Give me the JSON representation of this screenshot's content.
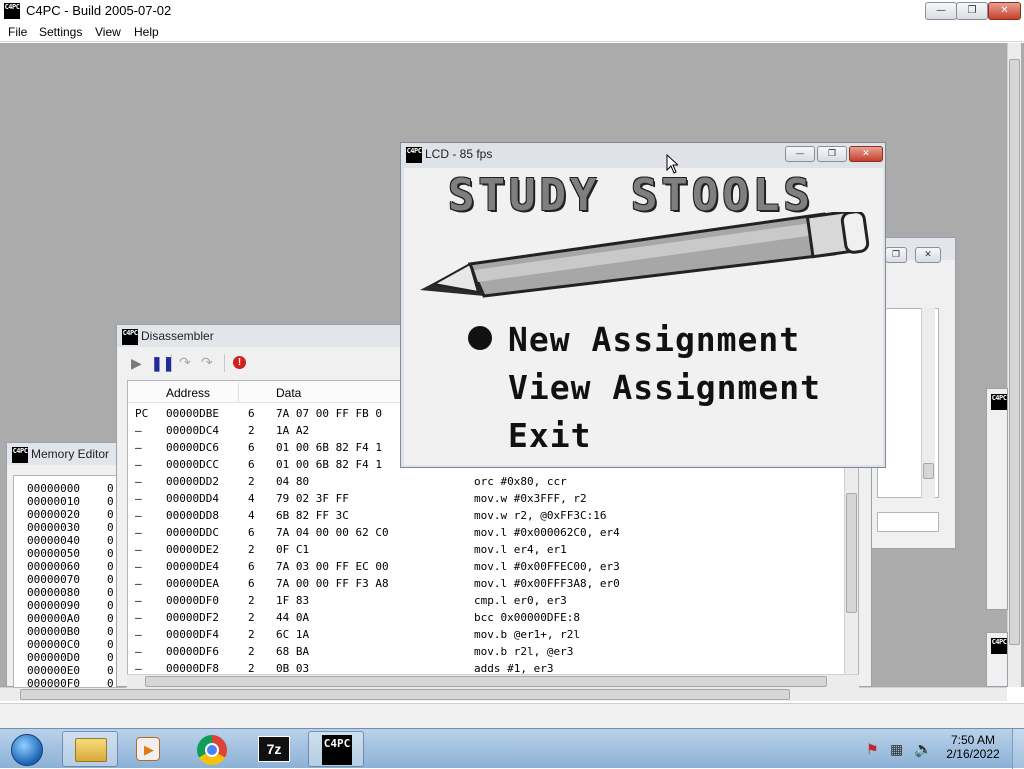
{
  "window": {
    "title": "C4PC - Build 2005-07-02",
    "icon_text": "C4PC",
    "minimize": "—",
    "restore": "❐",
    "close": "✕"
  },
  "menu": [
    "File",
    "Settings",
    "View",
    "Help"
  ],
  "lcd": {
    "title": "LCD - 85 fps",
    "screen_title": "STUDY STOOLS",
    "selected_index": 0,
    "menu_items": [
      "New Assignment",
      "View Assignment",
      "Exit"
    ]
  },
  "disassembler": {
    "title": "Disassembler",
    "columns": [
      "Address",
      "Data"
    ],
    "rows": [
      {
        "marker": "PC",
        "address": "00000DBE",
        "size": "6",
        "data": "7A 07 00 FF FB 0",
        "instr": ""
      },
      {
        "marker": "–",
        "address": "00000DC4",
        "size": "2",
        "data": "1A A2",
        "instr": ""
      },
      {
        "marker": "–",
        "address": "00000DC6",
        "size": "6",
        "data": "01 00 6B 82 F4 1",
        "instr": ""
      },
      {
        "marker": "–",
        "address": "00000DCC",
        "size": "6",
        "data": "01 00 6B 82 F4 1",
        "instr": ""
      },
      {
        "marker": "–",
        "address": "00000DD2",
        "size": "2",
        "data": "04 80",
        "instr": "orc #0x80, ccr"
      },
      {
        "marker": "–",
        "address": "00000DD4",
        "size": "4",
        "data": "79 02 3F FF",
        "instr": "mov.w #0x3FFF, r2"
      },
      {
        "marker": "–",
        "address": "00000DD8",
        "size": "4",
        "data": "6B 82 FF 3C",
        "instr": "mov.w r2, @0xFF3C:16"
      },
      {
        "marker": "–",
        "address": "00000DDC",
        "size": "6",
        "data": "7A 04 00 00 62 C0",
        "instr": "mov.l #0x000062C0, er4"
      },
      {
        "marker": "–",
        "address": "00000DE2",
        "size": "2",
        "data": "0F C1",
        "instr": "mov.l er4, er1"
      },
      {
        "marker": "–",
        "address": "00000DE4",
        "size": "6",
        "data": "7A 03 00 FF EC 00",
        "instr": "mov.l #0x00FFEC00, er3"
      },
      {
        "marker": "–",
        "address": "00000DEA",
        "size": "6",
        "data": "7A 00 00 FF F3 A8",
        "instr": "mov.l #0x00FFF3A8, er0"
      },
      {
        "marker": "–",
        "address": "00000DF0",
        "size": "2",
        "data": "1F 83",
        "instr": "cmp.l er0, er3"
      },
      {
        "marker": "–",
        "address": "00000DF2",
        "size": "2",
        "data": "44 0A",
        "instr": "bcc 0x00000DFE:8"
      },
      {
        "marker": "–",
        "address": "00000DF4",
        "size": "2",
        "data": "6C 1A",
        "instr": "mov.b @er1+, r2l"
      },
      {
        "marker": "–",
        "address": "00000DF6",
        "size": "2",
        "data": "68 BA",
        "instr": "mov.b r2l, @er3"
      },
      {
        "marker": "–",
        "address": "00000DF8",
        "size": "2",
        "data": "0B 03",
        "instr": "adds #1, er3"
      }
    ]
  },
  "memory_editor": {
    "title": "Memory Editor",
    "addresses": [
      "00000000",
      "00000010",
      "00000020",
      "00000030",
      "00000040",
      "00000050",
      "00000060",
      "00000070",
      "00000080",
      "00000090",
      "000000A0",
      "000000B0",
      "000000C0",
      "000000D0",
      "000000E0",
      "000000F0"
    ],
    "col_fragment": "0"
  },
  "taskbar": {
    "time": "7:50 AM",
    "date": "2/16/2022",
    "apps": [
      "start-orb",
      "explorer",
      "media-player",
      "chrome",
      "7z",
      "c4pc"
    ],
    "zip_label": "7z"
  },
  "colors": {
    "workspace": "#ababab",
    "close_red": "#c5412b",
    "taskbar": "#a6c3e0"
  }
}
